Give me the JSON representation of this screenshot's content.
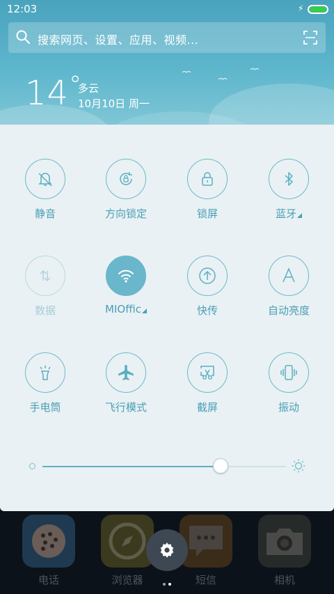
{
  "status_bar": {
    "time": "12:03"
  },
  "search": {
    "placeholder": "搜索网页、设置、应用、视频..."
  },
  "weather": {
    "temperature": "14",
    "degree_symbol": "°",
    "condition": "多云",
    "date": "10月10日 周一"
  },
  "quick_settings": {
    "tiles": [
      {
        "label": "静音",
        "icon": "mute-bell-icon",
        "active": false,
        "enabled": true
      },
      {
        "label": "方向锁定",
        "icon": "rotation-lock-icon",
        "active": false,
        "enabled": true
      },
      {
        "label": "锁屏",
        "icon": "lock-icon",
        "active": false,
        "enabled": true
      },
      {
        "label": "蓝牙",
        "icon": "bluetooth-icon",
        "active": false,
        "enabled": true,
        "has_menu": true
      },
      {
        "label": "数据",
        "icon": "mobile-data-icon",
        "active": false,
        "enabled": false
      },
      {
        "label": "MIOffic",
        "icon": "wifi-icon",
        "active": true,
        "enabled": true,
        "has_menu": true
      },
      {
        "label": "快传",
        "icon": "quick-transfer-icon",
        "active": false,
        "enabled": true
      },
      {
        "label": "自动亮度",
        "icon": "auto-brightness-icon",
        "active": false,
        "enabled": true
      },
      {
        "label": "手电筒",
        "icon": "flashlight-icon",
        "active": false,
        "enabled": true
      },
      {
        "label": "飞行模式",
        "icon": "airplane-icon",
        "active": false,
        "enabled": true
      },
      {
        "label": "截屏",
        "icon": "screenshot-icon",
        "active": false,
        "enabled": true
      },
      {
        "label": "振动",
        "icon": "vibrate-icon",
        "active": false,
        "enabled": true
      }
    ],
    "brightness": {
      "level": 0.73
    }
  },
  "dock": {
    "apps": [
      {
        "label": "电话",
        "icon": "phone-app-icon",
        "color": "#1f3a50"
      },
      {
        "label": "浏览器",
        "icon": "browser-app-icon",
        "color": "#3b3a1f"
      },
      {
        "label": "短信",
        "icon": "messages-app-icon",
        "color": "#3b2c1a"
      },
      {
        "label": "相机",
        "icon": "camera-app-icon",
        "color": "#262b2a"
      }
    ]
  },
  "colors": {
    "accent": "#6ab6cb",
    "panel": "#e9f1f4",
    "header_top": "#4aa3bd"
  }
}
